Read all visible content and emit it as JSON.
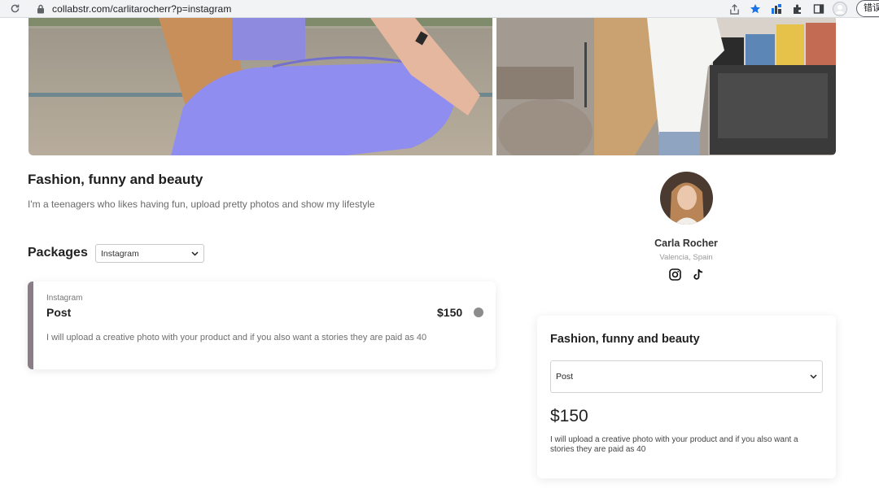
{
  "browser": {
    "url": "collabstr.com/carlitarocherr?p=instagram",
    "profile_label": "错误"
  },
  "hero": {
    "left_image": "woman-in-purple-outfit-photo",
    "right_image": "woman-in-white-shirt-photo"
  },
  "listing": {
    "title": "Fashion, funny and beauty",
    "description": "I'm a teenagers who likes having fun, upload pretty photos and show my lifestyle"
  },
  "packages": {
    "label": "Packages",
    "platform_select": "Instagram",
    "items": [
      {
        "platform": "Instagram",
        "name": "Post",
        "price": "$150",
        "description": "I will upload a creative photo with your product and if you also want a stories they are paid as 40"
      }
    ]
  },
  "profile": {
    "name": "Carla Rocher",
    "location": "Valencia, Spain",
    "socials": [
      "instagram-icon",
      "tiktok-icon"
    ]
  },
  "side_card": {
    "title": "Fashion, funny and beauty",
    "selected_package": "Post",
    "price": "$150",
    "description": "I will upload a creative photo with your product and if you also want a stories they are paid as 40"
  },
  "colors": {
    "accent_bar": "#8a7e86",
    "status_dot": "#8c8c8c"
  }
}
